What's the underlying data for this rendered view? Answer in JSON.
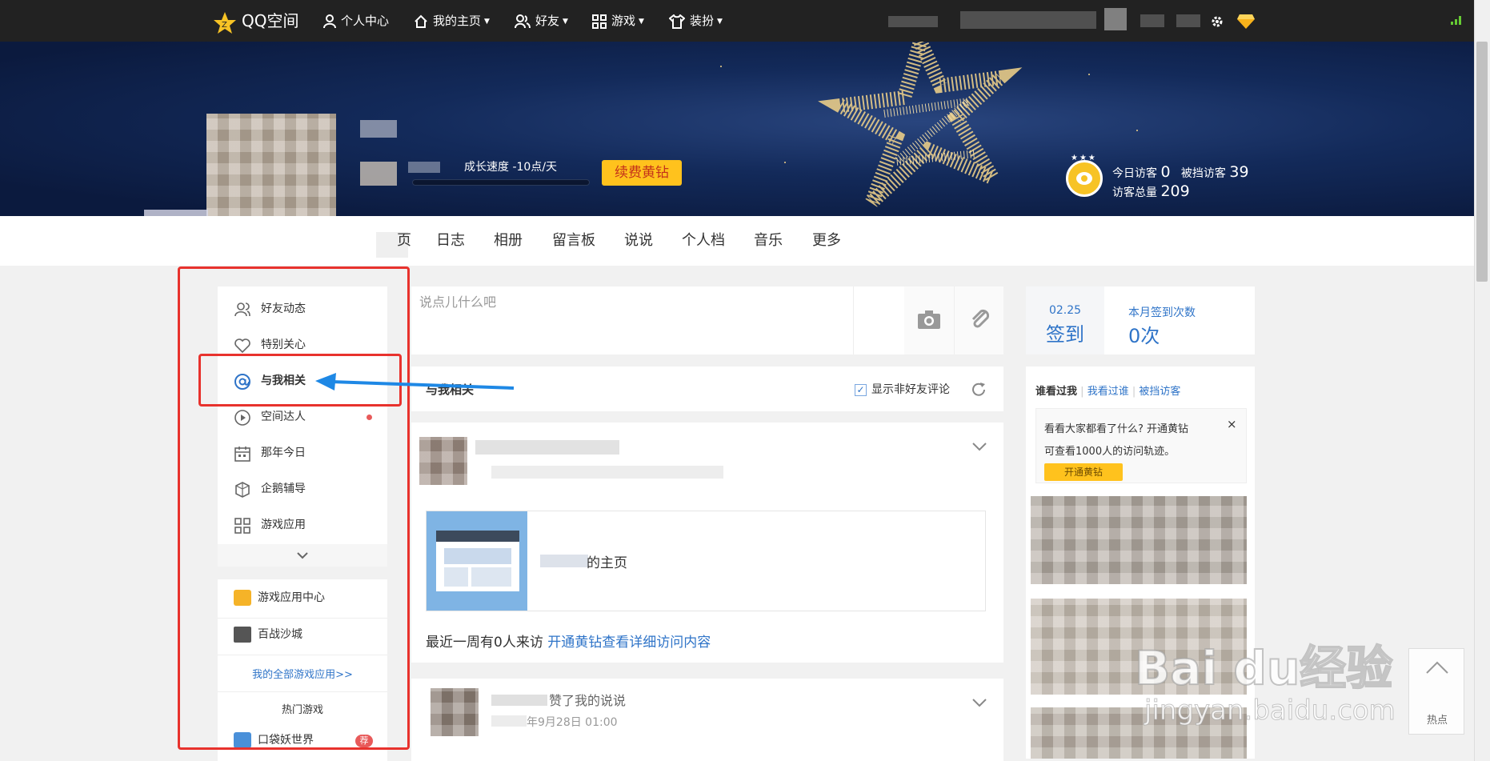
{
  "topbar": {
    "logo": "QQ空间",
    "items": [
      "个人中心",
      "我的主页",
      "好友",
      "游戏",
      "装扮"
    ]
  },
  "profile": {
    "growth": "成长速度 -10点/天",
    "renew_button": "续费黄钻",
    "today_visitors_label": "今日访客",
    "today_visitors": "0",
    "blocked_label": "被挡访客",
    "blocked": "39",
    "total_label": "访客总量",
    "total": "209"
  },
  "nav": {
    "home_fragment": "页",
    "tabs": [
      "日志",
      "相册",
      "留言板",
      "说说",
      "个人档",
      "音乐",
      "更多"
    ]
  },
  "sidebar": {
    "items": [
      {
        "label": "好友动态",
        "icon": "friends-icon"
      },
      {
        "label": "特别关心",
        "icon": "heart-icon"
      },
      {
        "label": "与我相关",
        "icon": "at-icon"
      },
      {
        "label": "空间达人",
        "icon": "play-icon"
      },
      {
        "label": "那年今日",
        "icon": "calendar-icon"
      },
      {
        "label": "企鹅辅导",
        "icon": "penguin-icon"
      },
      {
        "label": "游戏应用",
        "icon": "grid-icon"
      }
    ],
    "game_center": "游戏应用中心",
    "game_1": "百战沙城",
    "all_games": "我的全部游戏应用>>",
    "hot_games": "热门游戏",
    "game_2": "口袋妖世界",
    "badge": "荐"
  },
  "composer": {
    "placeholder": "说点儿什么吧"
  },
  "feed_header": {
    "title": "与我相关",
    "option": "显示非好友评论"
  },
  "card1": {
    "link_title": "的主页",
    "visit_text": "最近一周有0人来访",
    "visit_link": "开通黄钻查看详细访问内容"
  },
  "card2": {
    "text": "赞了我的说说",
    "time": "年9月28日 01:00"
  },
  "signin": {
    "date": "02.25",
    "label": "签到",
    "monthly_label": "本月签到次数",
    "monthly": "0次"
  },
  "visitors": {
    "tabs": [
      "谁看过我",
      "我看过谁",
      "被挡访客"
    ],
    "notice_line1": "大家都看了什么? 开通黄钻",
    "notice_prefix": "看看",
    "notice_line2": "可查看1000人的访问轨迹。",
    "notice_button": "开通黄钻",
    "close": "×"
  },
  "hot_button": "热点",
  "watermark": {
    "brand": "Bai du经验",
    "url": "jingyan.baidu.com"
  },
  "colors": {
    "accent_blue": "#2f74c8",
    "gold": "#ffc21d",
    "annotation_red": "#e8322d",
    "arrow_blue": "#1e88e5"
  }
}
